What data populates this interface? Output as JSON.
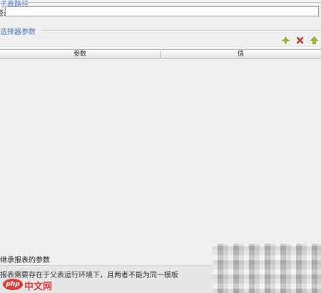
{
  "report_path": {
    "group_label": "子表路径",
    "field_label": "径:",
    "value": ""
  },
  "parameters": {
    "group_label": "选择器参数",
    "toolbar": {
      "add_icon": "add-plus-icon",
      "delete_icon": "delete-x-icon",
      "move_up_icon": "arrow-up-icon"
    },
    "columns": [
      "参数",
      "值"
    ],
    "rows": []
  },
  "inherit_checkbox": {
    "label": "继承报表的参数",
    "checked": false
  },
  "info": {
    "text": "报表需要存在于父表运行环境下，且两者不能为同一模板"
  },
  "watermark": {
    "logo_text": "php",
    "site_text": "中文网"
  },
  "colors": {
    "group_label": "#4a78c2",
    "add_icon": "#8fbf2a",
    "delete_icon": "#c0392b",
    "up_icon": "#8fbf2a"
  }
}
